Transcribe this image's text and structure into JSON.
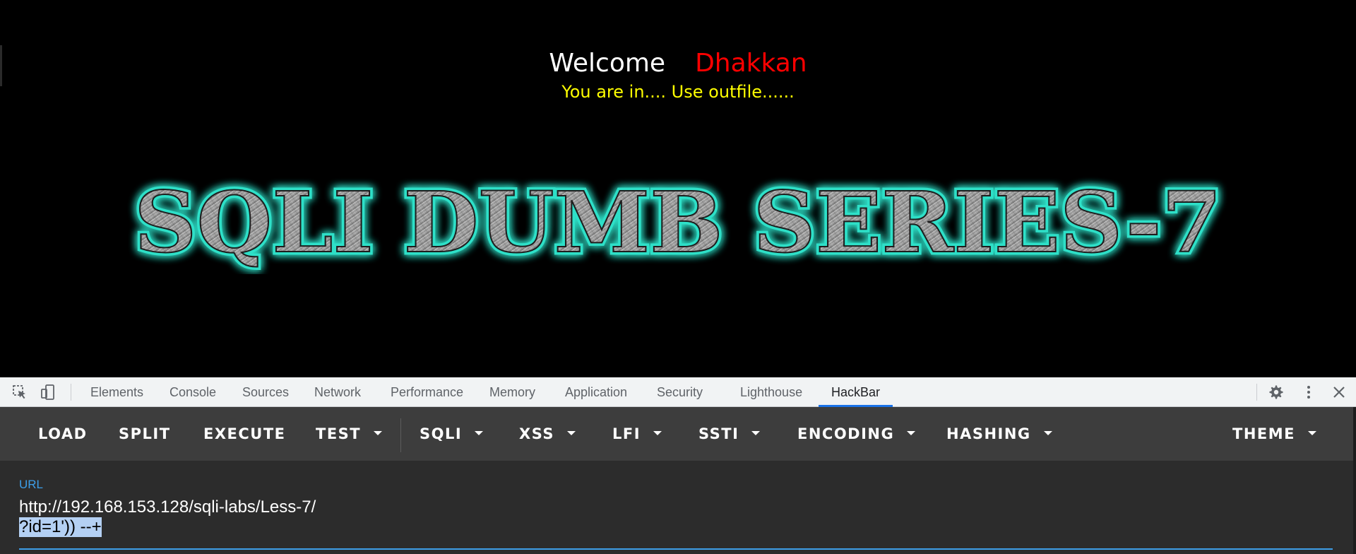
{
  "page": {
    "welcome_word": "Welcome",
    "welcome_name": "Dhakkan",
    "message": "You are in.... Use outfile......",
    "banner_text": "SQLI DUMB SERIES-7",
    "colors": {
      "background": "#000000",
      "welcome": "#ffffff",
      "name": "#ff0000",
      "message": "#ffff00",
      "banner_glow": "#2de0c8"
    }
  },
  "devtools": {
    "icons": [
      "inspect-element-icon",
      "device-toolbar-icon",
      "settings-gear-icon",
      "more-vertical-icon",
      "close-icon"
    ],
    "tabs": [
      {
        "label": "Elements"
      },
      {
        "label": "Console"
      },
      {
        "label": "Sources"
      },
      {
        "label": "Network"
      },
      {
        "label": "Performance"
      },
      {
        "label": "Memory"
      },
      {
        "label": "Application"
      },
      {
        "label": "Security"
      },
      {
        "label": "Lighthouse"
      },
      {
        "label": "HackBar"
      }
    ],
    "active_tab": "HackBar"
  },
  "hackbar": {
    "buttons": [
      {
        "label": "LOAD"
      },
      {
        "label": "SPLIT"
      },
      {
        "label": "EXECUTE"
      },
      {
        "label": "TEST"
      },
      {
        "label": "SQLI"
      },
      {
        "label": "XSS"
      },
      {
        "label": "LFI"
      },
      {
        "label": "SSTI"
      },
      {
        "label": "ENCODING"
      },
      {
        "label": "HASHING"
      },
      {
        "label": "THEME"
      }
    ],
    "url_label": "URL",
    "url_line1": "http://192.168.153.128/sqli-labs/Less-7/",
    "url_line2": "?id=1')) --+",
    "accent_color": "#3d9ee8"
  }
}
